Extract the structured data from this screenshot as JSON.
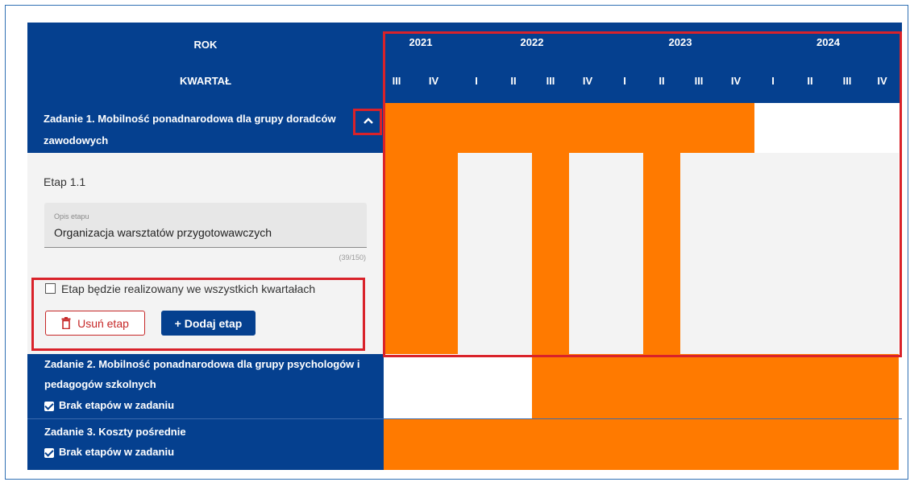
{
  "header": {
    "year_label": "ROK",
    "quarter_label": "KWARTAŁ",
    "years": [
      "2021",
      "2022",
      "2023",
      "2024"
    ],
    "quarters": [
      "III",
      "IV",
      "I",
      "II",
      "III",
      "IV",
      "I",
      "II",
      "III",
      "IV",
      "I",
      "II",
      "III",
      "IV"
    ]
  },
  "tasks": [
    {
      "title": "Zadanie 1. Mobilność ponadnarodowa dla grupy doradców zawodowych",
      "title_line1": "Zadanie 1. Mobilność ponadnarodowa dla grupy doradców",
      "title_line2": "zawodowych",
      "active_quarters": [
        1,
        1,
        1,
        1,
        1,
        1,
        1,
        1,
        1,
        1,
        0,
        0,
        0,
        0
      ]
    },
    {
      "title": "Zadanie 2. Mobilność ponadnarodowa dla grupy psychologów i pedagogów szkolnych",
      "title_line1": "Zadanie 2. Mobilność ponadnarodowa dla grupy psychologów i",
      "title_line2": "pedagogów szkolnych",
      "no_stages_label": "Brak etapów w zadaniu",
      "no_stages_checked": true,
      "active_quarters": [
        0,
        0,
        0,
        0,
        1,
        1,
        1,
        1,
        1,
        1,
        1,
        1,
        1,
        1
      ]
    },
    {
      "title": "Zadanie 3. Koszty pośrednie",
      "no_stages_label": "Brak etapów w zadaniu",
      "no_stages_checked": true,
      "active_quarters": [
        1,
        1,
        1,
        1,
        1,
        1,
        1,
        1,
        1,
        1,
        1,
        1,
        1,
        1
      ]
    }
  ],
  "stage": {
    "title": "Etap 1.1",
    "description_label": "Opis etapu",
    "description_value": "Organizacja warsztatów przygotowawczych",
    "char_counter": "(39/150)",
    "all_quarters_label": "Etap będzie realizowany we wszystkich kwartałach",
    "all_quarters_checked": false,
    "remove_label": "Usuń etap",
    "add_label": "+ Dodaj etap",
    "active_quarters": [
      1,
      1,
      0,
      0,
      1,
      0,
      0,
      1,
      0,
      0,
      0,
      0,
      0,
      0
    ]
  },
  "colors": {
    "brand_blue": "#05408f",
    "active_orange": "#ff7a00",
    "highlight_red": "#d9222a",
    "button_red": "#c62828"
  }
}
